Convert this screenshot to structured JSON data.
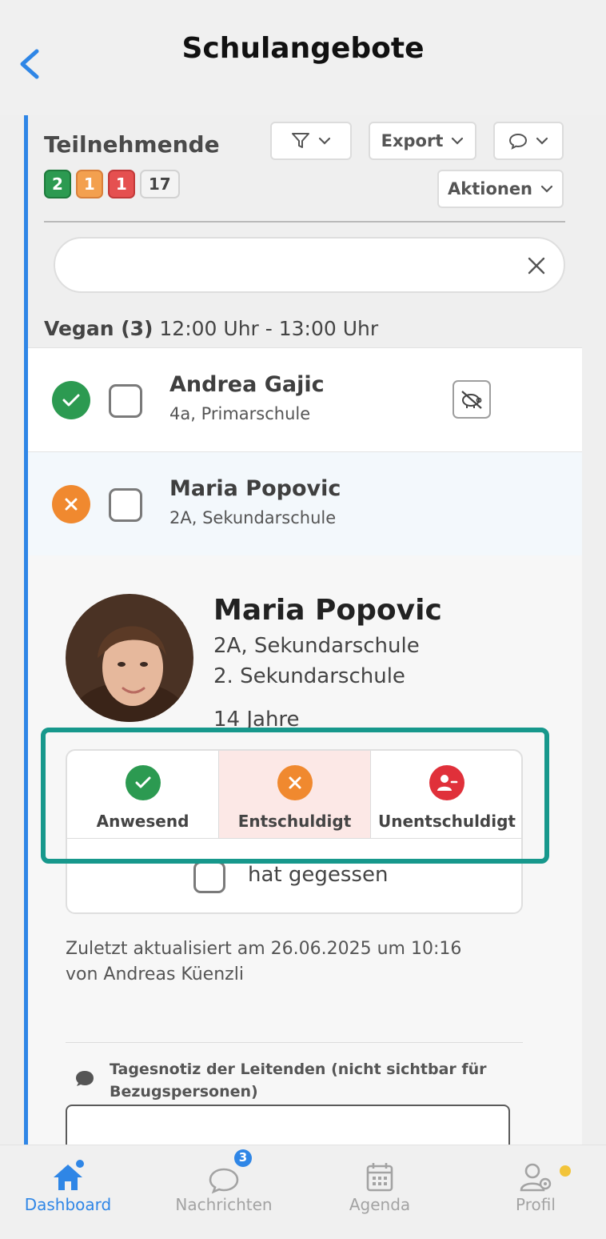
{
  "header": {
    "title": "Schulangebote"
  },
  "toolbar": {
    "section_title": "Teilnehmende",
    "badges": [
      "2",
      "1",
      "1",
      "17"
    ],
    "export_label": "Export",
    "actions_label": "Aktionen"
  },
  "search": {
    "value": "",
    "placeholder": ""
  },
  "group": {
    "name": "Vegan (3)",
    "time": "12:00 Uhr - 13:00 Uhr"
  },
  "participants": [
    {
      "name": "Andrea Gajic",
      "sub": "4a, Primarschule",
      "status": "anwesend"
    },
    {
      "name": "Maria Popovic",
      "sub": "2A, Sekundarschule",
      "status": "entschuldigt"
    }
  ],
  "detail": {
    "name": "Maria Popovic",
    "class_line": "2A, Sekundarschule",
    "school_line": "2. Sekundarschule",
    "age": "14 Jahre",
    "attendance": {
      "present": "Anwesend",
      "excused": "Entschuldigt",
      "unexcused": "Unentschuldigt",
      "selected": "Entschuldigt"
    },
    "ate_label": "hat gegessen",
    "updated_line1": "Zuletzt aktualisiert am 26.06.2025 um 10:16",
    "updated_line2": "von Andreas Küenzli",
    "note_label": "Tagesnotiz der Leitenden (nicht sichtbar für Bezugspersonen)"
  },
  "tabbar": {
    "dashboard": "Dashboard",
    "messages": "Nachrichten",
    "messages_badge": "3",
    "agenda": "Agenda",
    "profile": "Profil"
  },
  "colors": {
    "accent": "#2f86e6",
    "present": "#2c9a51",
    "excused": "#f0892f",
    "unexcused": "#e0303a",
    "highlight": "#17988c"
  }
}
